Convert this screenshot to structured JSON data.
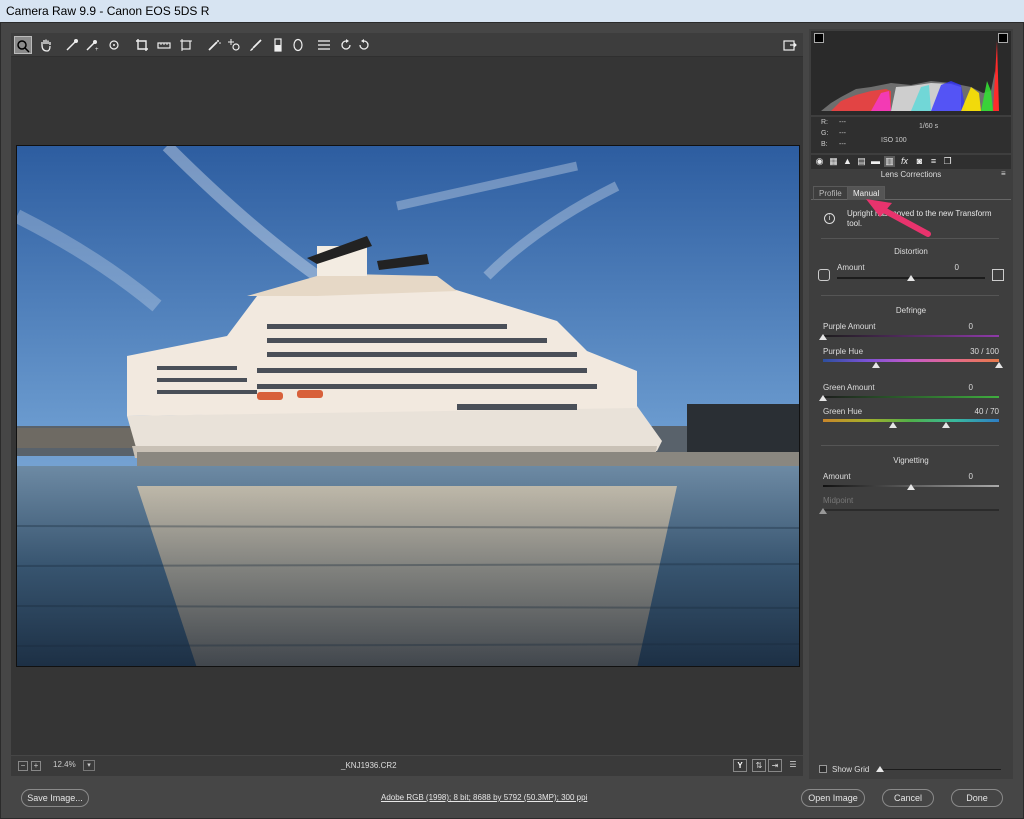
{
  "app": {
    "title": "Camera Raw 9.9  -  Canon EOS 5DS R"
  },
  "toolbar": {
    "tools": [
      {
        "name": "zoom-tool",
        "glyph": "🔍"
      },
      {
        "name": "hand-tool",
        "glyph": "✋"
      },
      {
        "name": "white-balance-tool",
        "glyph": "✎"
      },
      {
        "name": "color-sampler-tool",
        "glyph": "✎"
      },
      {
        "name": "targeted-adjustment-tool",
        "glyph": "◎"
      },
      {
        "name": "crop-tool",
        "glyph": "⌗"
      },
      {
        "name": "straighten-tool",
        "glyph": "▭"
      },
      {
        "name": "transform-tool",
        "glyph": "⊡"
      },
      {
        "name": "spot-removal-tool",
        "glyph": "✐"
      },
      {
        "name": "red-eye-tool",
        "glyph": "⊹"
      },
      {
        "name": "adjustment-brush-tool",
        "glyph": "✏"
      },
      {
        "name": "graduated-filter-tool",
        "glyph": "▮"
      },
      {
        "name": "radial-filter-tool",
        "glyph": "◯"
      },
      {
        "name": "preferences-tool",
        "glyph": "☰"
      },
      {
        "name": "rotate-ccw-tool",
        "glyph": "↺"
      },
      {
        "name": "rotate-cw-tool",
        "glyph": "↻"
      }
    ],
    "fullscreen_glyph": "⇱"
  },
  "status": {
    "zoom": "12.4%",
    "filename": "_KNJ1936.CR2",
    "view_before_after": "Y"
  },
  "readout": {
    "r_label": "R:",
    "g_label": "G:",
    "b_label": "B:",
    "r_val": "---",
    "g_val": "---",
    "b_val": "---",
    "shutter": "1/60 s",
    "iso": "ISO 100"
  },
  "panel": {
    "title": "Lens Corrections",
    "tabs": [
      "Profile",
      "Manual"
    ],
    "info_text": "Upright has moved to the new Transform tool.",
    "distortion": {
      "heading": "Distortion",
      "amount_label": "Amount",
      "amount_value": "0",
      "amount_pos": 0.5
    },
    "defringe": {
      "heading": "Defringe",
      "purple_amount_label": "Purple Amount",
      "purple_amount_value": "0",
      "purple_amount_pos": 0.0,
      "purple_hue_label": "Purple Hue",
      "purple_hue_value": "30 / 100",
      "purple_hue_range": [
        0.3,
        1.0
      ],
      "green_amount_label": "Green Amount",
      "green_amount_value": "0",
      "green_amount_pos": 0.0,
      "green_hue_label": "Green Hue",
      "green_hue_value": "40 / 70",
      "green_hue_range": [
        0.4,
        0.7
      ]
    },
    "vignetting": {
      "heading": "Vignetting",
      "amount_label": "Amount",
      "amount_value": "0",
      "amount_pos": 0.5,
      "midpoint_label": "Midpoint",
      "midpoint_pos": 0.0
    },
    "show_grid_label": "Show Grid"
  },
  "footer": {
    "save_label": "Save Image...",
    "workflow_info": "Adobe RGB (1998); 8 bit; 8688 by 5792 (50.3MP); 300 ppi",
    "open_label": "Open Image",
    "cancel_label": "Cancel",
    "done_label": "Done"
  },
  "colors": {
    "accent_arrow": "#e8336d",
    "panel_bg": "#3e3e3e",
    "window_bg": "#464646"
  }
}
